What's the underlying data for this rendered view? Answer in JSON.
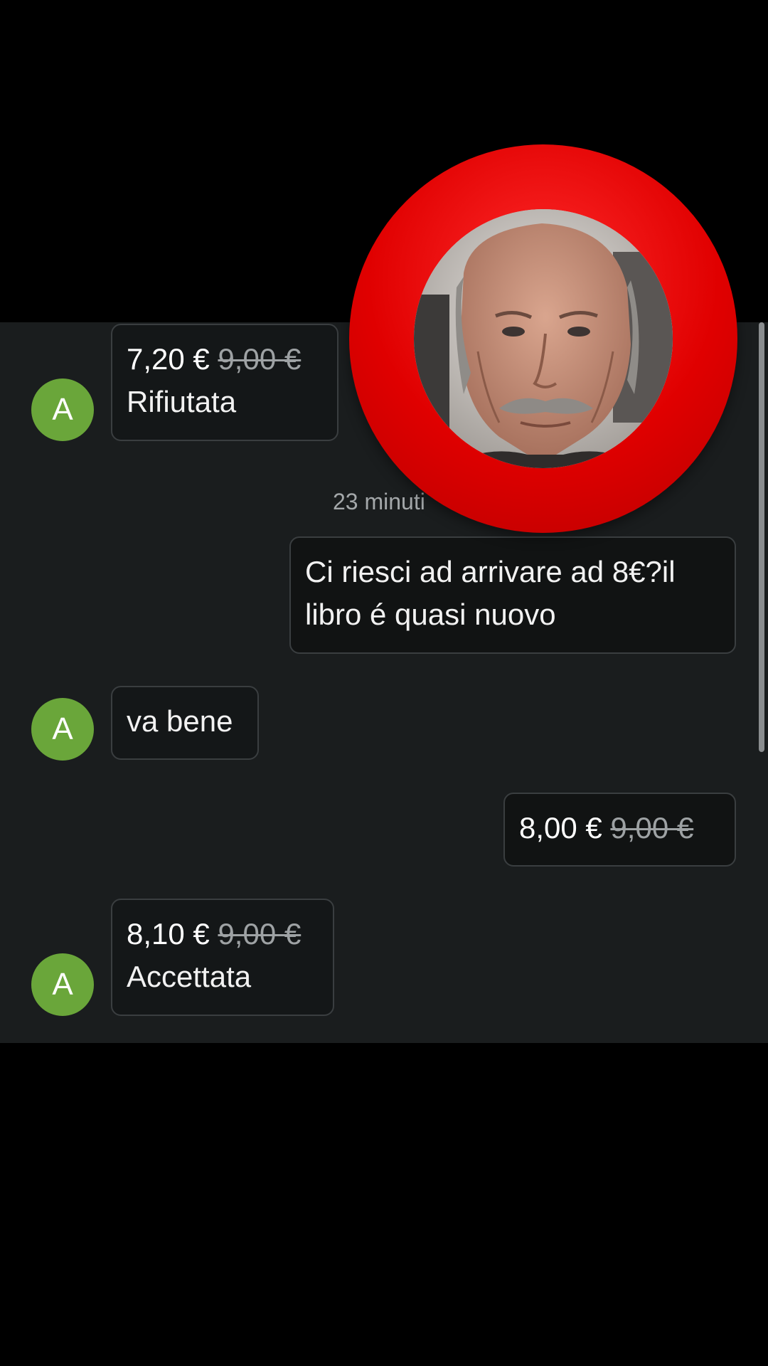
{
  "messages": {
    "offer1": {
      "sender_initial": "A",
      "price_new": "7,20 €",
      "price_old": "9,00 €",
      "status": "Rifiutata"
    },
    "timestamp": "23 minuti",
    "outgoing1": {
      "line1": "Ci riesci ad arrivare ad 8€?il",
      "line2": "libro é quasi nuovo"
    },
    "incoming1": {
      "sender_initial": "A",
      "text": "va bene"
    },
    "outgoing_offer": {
      "price_new": "8,00 €",
      "price_old": "9,00 €"
    },
    "offer2": {
      "sender_initial": "A",
      "price_new": "8,10 €",
      "price_old": "9,00 €",
      "status": "Accettata"
    }
  },
  "colors": {
    "avatar": "#6aa63a",
    "chat_background": "#1a1d1e",
    "ring": "#e00000"
  },
  "video_overlay": {
    "icon": "person-photo"
  }
}
